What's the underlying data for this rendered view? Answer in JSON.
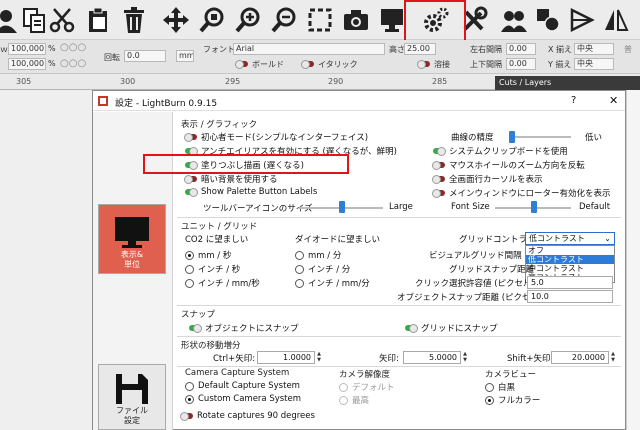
{
  "toolbar": {
    "icons": [
      "user-icon",
      "copy-icon",
      "cut-icon",
      "paste-icon",
      "delete-icon",
      "move-icon",
      "zoom-icon",
      "zoom-in-icon",
      "zoom-out-icon",
      "select-frame-icon",
      "camera-icon",
      "monitor-icon",
      "settings-icon",
      "tools-icon",
      "users-icon",
      "shapes-icon",
      "triangle-icon",
      "flip-icon"
    ]
  },
  "optbar": {
    "x_val": "100,000",
    "y_val": "100,000",
    "pct": "%",
    "rotate_label": "回転",
    "rotate_val": "0.0",
    "mm_label": "mm",
    "font_label": "フォント",
    "font_val": "Arial",
    "height_label": "高さ",
    "height_val": "25.00",
    "hspace_label": "左右間隔",
    "hspace_val": "0.00",
    "align_x_label": "X 揃え",
    "align_x_val": "中央",
    "bold_label": "ボールド",
    "italic_label": "イタリック",
    "weld_label": "溶接",
    "vspace_label": "上下間隔",
    "vspace_val": "0.00",
    "align_y_label": "Y 揃え",
    "align_y_val": "中央"
  },
  "ruler": {
    "marks": [
      "305",
      "300",
      "295",
      "290",
      "285"
    ]
  },
  "cuts_layers": "Cuts / Layers",
  "dialog": {
    "title": "設定 - LightBurn 0.9.15",
    "help": "?",
    "close": "✕",
    "sidebar": {
      "display_label": "表示&\n単位",
      "file_label": "ファイル\n設定"
    },
    "display_group": {
      "title": "表示 / グラフィック",
      "left_toggles": [
        {
          "label": "初心者モード(シンプルなインターフェイス)",
          "on": false
        },
        {
          "label": "アンチエイリアスを有効にする (遅くなるが、鮮明)",
          "on": true
        },
        {
          "label": "塗りつぶし描画 (遅くなる)",
          "on": true
        },
        {
          "label": "暗い背景を使用する",
          "on": false
        },
        {
          "label": "Show Palette Button Labels",
          "on": true
        }
      ],
      "curve_label": "曲線の精度",
      "curve_low": "低い",
      "right_toggles": [
        {
          "label": "システムクリップボードを使用",
          "on": true
        },
        {
          "label": "マウスホイールのズーム方向を反転",
          "on": false
        },
        {
          "label": "全画面行カーソルを表示",
          "on": false
        },
        {
          "label": "メインウィンドウにローター有効化を表示",
          "on": false
        }
      ],
      "toolbar_icon_label": "ツールバーアイコンのサイズ",
      "toolbar_icon_large": "Large",
      "font_size_label": "Font Size",
      "font_size_default": "Default"
    },
    "units_group": {
      "title": "ユニット / グリッド",
      "co2_label": "CO2 に望ましい",
      "co2_options": [
        {
          "label": "mm / 秒",
          "selected": true
        },
        {
          "label": "インチ / 秒",
          "selected": false
        },
        {
          "label": "インチ / mm/秒",
          "selected": false
        }
      ],
      "diode_label": "ダイオードに望ましい",
      "diode_options": [
        {
          "label": "mm / 分",
          "selected": false
        },
        {
          "label": "インチ / 分",
          "selected": false
        },
        {
          "label": "インチ / mm/分",
          "selected": false
        }
      ],
      "grid_contrast_label": "グリッドコントラスト",
      "grid_contrast_val": "低コントラスト",
      "grid_contrast_options": [
        "オフ",
        "低コントラスト",
        "中コントラスト",
        "高コントラスト"
      ],
      "visual_grid_label": "ビジュアルグリッド間隔",
      "grid_snap_label": "グリッドスナップ距離",
      "click_tolerance_label": "クリック選択許容値 (ピクセル)",
      "click_tolerance_val": "5.0",
      "object_snap_label": "オブジェクトスナップ距離 (ピクセル)",
      "object_snap_val": "10.0"
    },
    "snap_group": {
      "title": "スナップ",
      "object_snap": "オブジェクトにスナップ",
      "grid_snap": "グリッドにスナップ"
    },
    "move_group": {
      "title": "形状の移動増分",
      "ctrl_label": "Ctrl+矢印:",
      "ctrl_val": "1.0000",
      "arrow_label": "矢印:",
      "arrow_val": "5.0000",
      "shift_label": "Shift+矢印:",
      "shift_val": "20.0000"
    },
    "camera_group": {
      "title": "Camera Capture System",
      "options": [
        {
          "label": "Default Capture System",
          "selected": false
        },
        {
          "label": "Custom Camera System",
          "selected": true
        }
      ],
      "rotate_label": "Rotate captures 90 degrees"
    },
    "resolution_group": {
      "title": "カメラ解像度",
      "options": [
        {
          "label": "デフォルト",
          "selected": false
        },
        {
          "label": "最高",
          "selected": false
        }
      ]
    },
    "camview_group": {
      "title": "カメラビュー",
      "options": [
        {
          "label": "白黒",
          "selected": false
        },
        {
          "label": "フルカラー",
          "selected": true
        }
      ]
    }
  }
}
